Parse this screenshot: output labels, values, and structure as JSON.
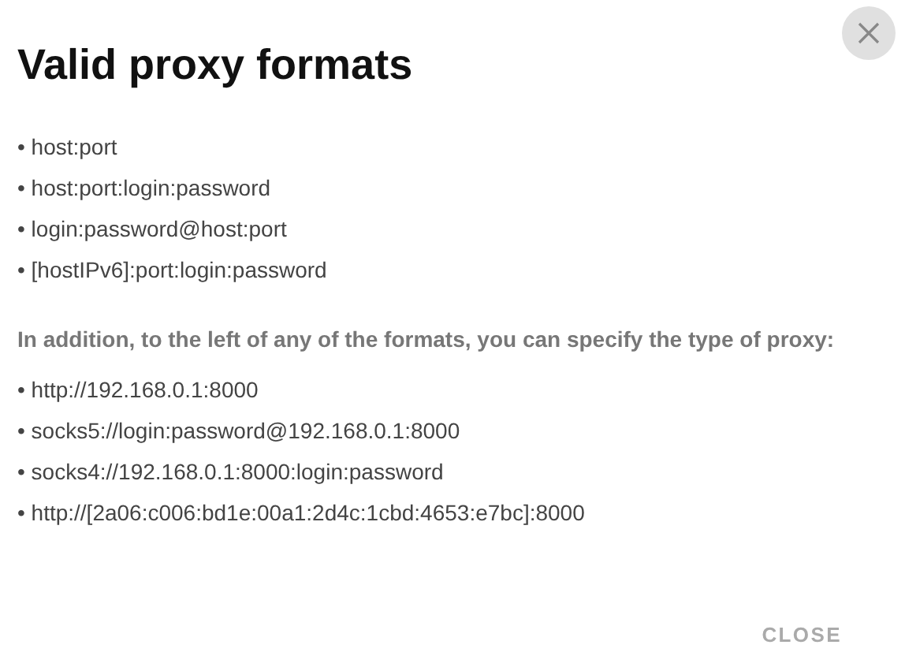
{
  "dialog": {
    "title": "Valid proxy formats",
    "formats": [
      "• host:port",
      "• host:port:login:password",
      "• login:password@host:port",
      "• [hostIPv6]:port:login:password"
    ],
    "note": "In addition, to the left of any of the formats, you can specify the type of proxy:",
    "examples": [
      "• http://192.168.0.1:8000",
      "• socks5://login:password@192.168.0.1:8000",
      "• socks4://192.168.0.1:8000:login:password",
      "• http://[2a06:c006:bd1e:00a1:2d4c:1cbd:4653:e7bc]:8000"
    ],
    "close_button": "CLOSE"
  }
}
